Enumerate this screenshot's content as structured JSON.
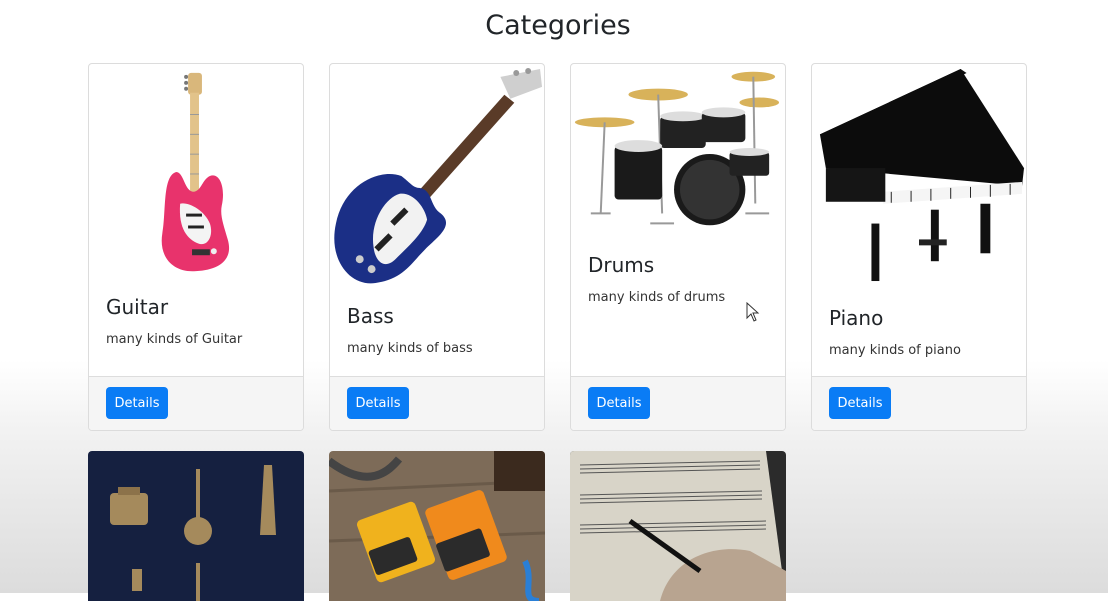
{
  "page": {
    "title": "Categories"
  },
  "categories": [
    {
      "title": "Guitar",
      "text": "many kinds of Guitar",
      "button": "Details",
      "icon": "electric-guitar-image"
    },
    {
      "title": "Bass",
      "text": "many kinds of bass",
      "button": "Details",
      "icon": "bass-guitar-image"
    },
    {
      "title": "Drums",
      "text": "many kinds of drums",
      "button": "Details",
      "icon": "drum-kit-image"
    },
    {
      "title": "Piano",
      "text": "many kinds of piano",
      "button": "Details",
      "icon": "grand-piano-image"
    }
  ],
  "more_categories": [
    {
      "icon": "instrument-pendants-image"
    },
    {
      "icon": "guitar-pedals-image"
    },
    {
      "icon": "sheet-music-image"
    }
  ],
  "colors": {
    "button": "#0a7cf5",
    "guitar_body": "#e8336c",
    "bass_body": "#1b2f86"
  }
}
